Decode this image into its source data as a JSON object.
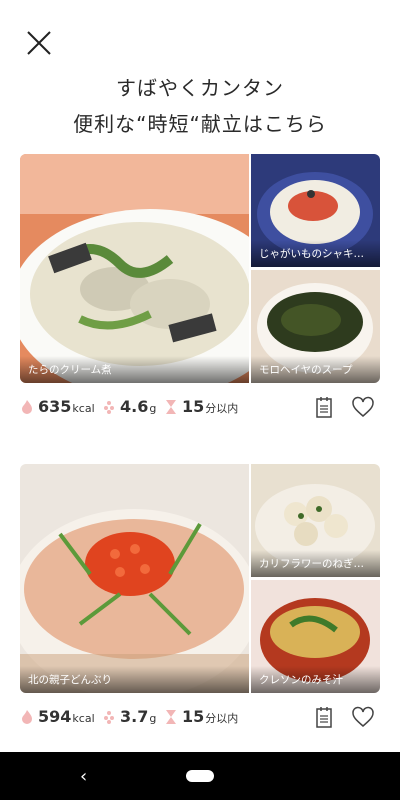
{
  "header": {
    "line1": "すばやくカンタン",
    "line2": "便利な“時短“献立はこちら"
  },
  "colors": {
    "accent": "#e8a0a0",
    "navbar": "#000000"
  },
  "menus": [
    {
      "main": {
        "caption": "たらのクリーム煮"
      },
      "side1": {
        "caption": "じゃがいものシャキシャキ"
      },
      "side2": {
        "caption": "モロヘイヤのスープ"
      },
      "stats": {
        "kcal": "635",
        "kcal_unit": "kcal",
        "salt": "4.6",
        "salt_unit": "g",
        "time": "15",
        "time_unit": "分以内"
      }
    },
    {
      "main": {
        "caption": "北の親子どんぶり"
      },
      "side1": {
        "caption": "カリフラワーのねぎじそ"
      },
      "side2": {
        "caption": "クレソンのみそ汁"
      },
      "stats": {
        "kcal": "594",
        "kcal_unit": "kcal",
        "salt": "3.7",
        "salt_unit": "g",
        "time": "15",
        "time_unit": "分以内"
      }
    }
  ],
  "icons": {
    "close": "close-icon",
    "calorie": "flame-icon",
    "salt": "salt-icon",
    "time": "hourglass-icon",
    "menu": "recipe-list-icon",
    "favorite": "heart-icon",
    "back": "back-icon",
    "home": "home-pill"
  },
  "navbar": {
    "back_glyph": "‹"
  }
}
